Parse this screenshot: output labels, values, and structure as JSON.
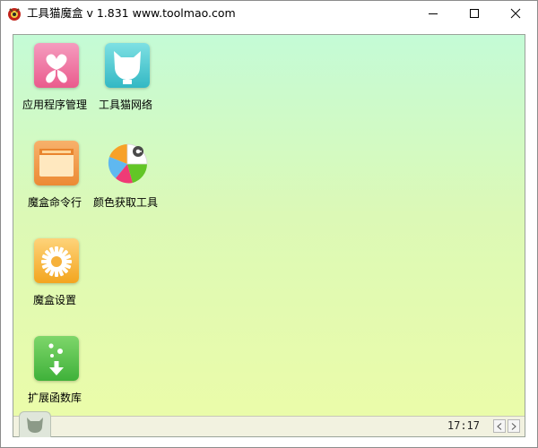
{
  "window": {
    "title": "工具猫魔盒 v 1.831 www.toolmao.com",
    "controls": [
      "minimize-icon",
      "maximize-icon",
      "close-icon"
    ]
  },
  "desktop": {
    "items": [
      {
        "label": "应用程序管理",
        "icon": "flower-icon",
        "color": "#f06b99"
      },
      {
        "label": "工具猫网络",
        "icon": "cat-icon",
        "color": "#46c6cf"
      },
      {
        "label": "魔盒命令行",
        "icon": "window-icon",
        "color": "#ef9a47"
      },
      {
        "label": "颜色获取工具",
        "icon": "color-picker-icon",
        "color": "#ffffff"
      },
      {
        "label": "魔盒设置",
        "icon": "gear-icon",
        "color": "#f3ad26"
      },
      {
        "label": "扩展函数库",
        "icon": "download-icon",
        "color": "#4fc04a"
      }
    ]
  },
  "statusbar": {
    "time": "17:17",
    "prev_icon": "chevron-left-icon",
    "next_icon": "chevron-right-icon"
  }
}
